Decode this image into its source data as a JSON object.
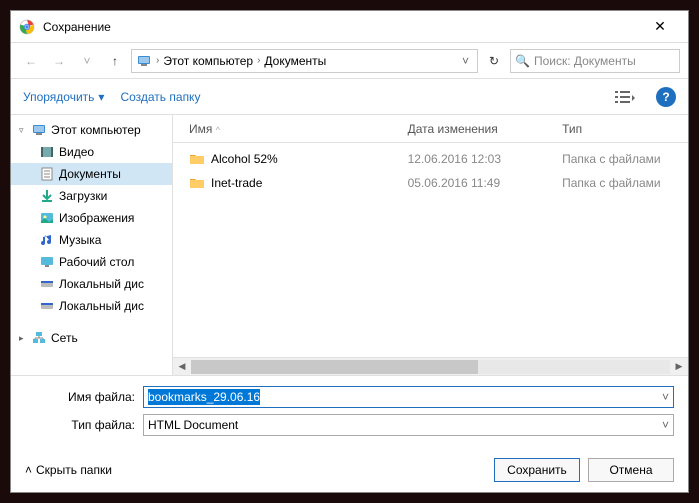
{
  "title": "Сохранение",
  "breadcrumb": {
    "root": "Этот компьютер",
    "folder": "Документы"
  },
  "search_placeholder": "Поиск: Документы",
  "toolbar": {
    "organize": "Упорядочить",
    "new_folder": "Создать папку",
    "help": "?"
  },
  "sidebar": {
    "root": "Этот компьютер",
    "items": [
      {
        "label": "Видео"
      },
      {
        "label": "Документы"
      },
      {
        "label": "Загрузки"
      },
      {
        "label": "Изображения"
      },
      {
        "label": "Музыка"
      },
      {
        "label": "Рабочий стол"
      },
      {
        "label": "Локальный дис"
      },
      {
        "label": "Локальный дис"
      }
    ],
    "network": "Сеть"
  },
  "columns": {
    "name": "Имя",
    "date": "Дата изменения",
    "type": "Тип"
  },
  "files": [
    {
      "name": "Alcohol 52%",
      "date": "12.06.2016 12:03",
      "type": "Папка с файлами"
    },
    {
      "name": "Inet-trade",
      "date": "05.06.2016 11:49",
      "type": "Папка с файлами"
    }
  ],
  "form": {
    "filename_label": "Имя файла:",
    "filename_value": "bookmarks_29.06.16",
    "filetype_label": "Тип файла:",
    "filetype_value": "HTML Document"
  },
  "bottom": {
    "hide_folders": "Скрыть папки",
    "save": "Сохранить",
    "cancel": "Отмена"
  }
}
